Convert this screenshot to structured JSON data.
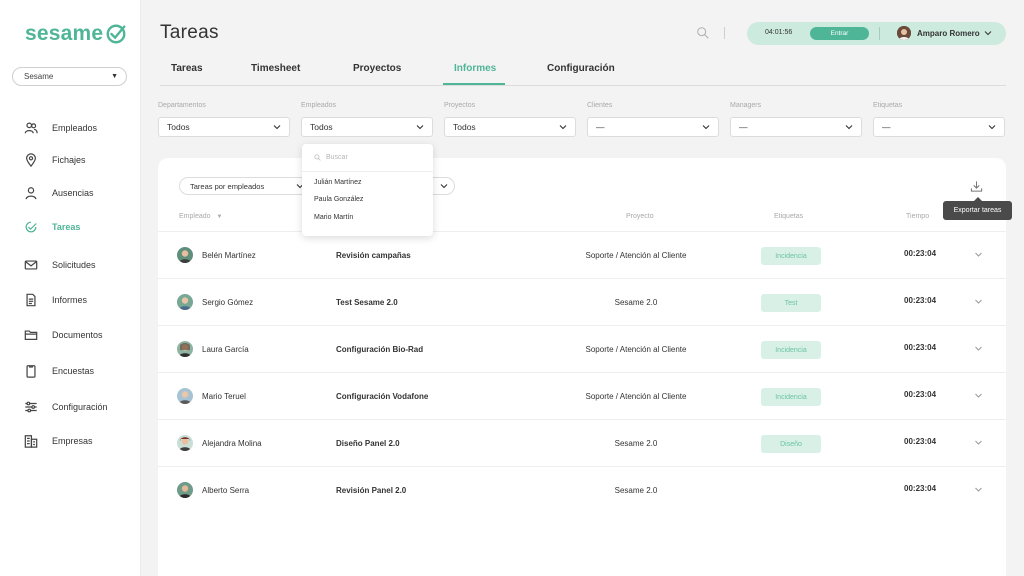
{
  "brand": {
    "logo_text": "sesame",
    "accent": "#4fb597"
  },
  "sidebar": {
    "company": "Sesame",
    "items": [
      {
        "label": "Empleados",
        "icon": "users-icon"
      },
      {
        "label": "Fichajes",
        "icon": "location-pin-icon"
      },
      {
        "label": "Ausencias",
        "icon": "person-icon"
      },
      {
        "label": "Tareas",
        "icon": "tasks-icon",
        "active": true
      },
      {
        "label": "Solicitudes",
        "icon": "mail-icon"
      },
      {
        "label": "Informes",
        "icon": "document-icon"
      },
      {
        "label": "Documentos",
        "icon": "folder-icon"
      },
      {
        "label": "Encuestas",
        "icon": "clipboard-icon"
      },
      {
        "label": "Configuración",
        "icon": "sliders-icon"
      },
      {
        "label": "Empresas",
        "icon": "building-icon"
      }
    ]
  },
  "header": {
    "title": "Tareas",
    "clock": "04:01:56",
    "entrar": "Entrar",
    "user": "Amparo Romero"
  },
  "tabs": [
    {
      "label": "Tareas"
    },
    {
      "label": "Timesheet"
    },
    {
      "label": "Proyectos"
    },
    {
      "label": "Informes",
      "active": true
    },
    {
      "label": "Configuración"
    }
  ],
  "filters": [
    {
      "label": "Departamentos",
      "value": "Todos"
    },
    {
      "label": "Empleados",
      "value": "Todos"
    },
    {
      "label": "Proyectos",
      "value": "Todos"
    },
    {
      "label": "Clientes",
      "value": "—"
    },
    {
      "label": "Managers",
      "value": "—"
    },
    {
      "label": "Etiquetas",
      "value": "—"
    }
  ],
  "dropdown": {
    "placeholder": "Buscar",
    "options": [
      "Julián Martínez",
      "Paula González",
      "Mario Martín"
    ]
  },
  "report": {
    "group_by": "Tareas por empleados",
    "export_tooltip": "Exportar tareas",
    "columns": {
      "employee": "Empleado",
      "project": "Proyecto",
      "tags": "Etiquetas",
      "time": "Tiempo"
    },
    "rows": [
      {
        "employee": "Belén Martínez",
        "task": "Revisión campañas",
        "project": "Soporte / Atención al Cliente",
        "tag": "Incidencia",
        "time": "00:23:04"
      },
      {
        "employee": "Sergio Gómez",
        "task": "Test Sesame 2.0",
        "project": "Sesame 2.0",
        "tag": "Test",
        "time": "00:23:04"
      },
      {
        "employee": "Laura García",
        "task": "Configuración Bio-Rad",
        "project": "Soporte / Atención al Cliente",
        "tag": "Incidencia",
        "time": "00:23:04"
      },
      {
        "employee": "Mario Teruel",
        "task": "Configuración Vodafone",
        "project": "Soporte / Atención al Cliente",
        "tag": "Incidencia",
        "time": "00:23:04"
      },
      {
        "employee": "Alejandra Molina",
        "task": "Diseño Panel 2.0",
        "project": "Sesame 2.0",
        "tag": "Diseño",
        "time": "00:23:04"
      },
      {
        "employee": "Alberto Serra",
        "task": "Revisión Panel 2.0",
        "project": "Sesame 2.0",
        "tag": "",
        "time": "00:23:04"
      }
    ]
  }
}
